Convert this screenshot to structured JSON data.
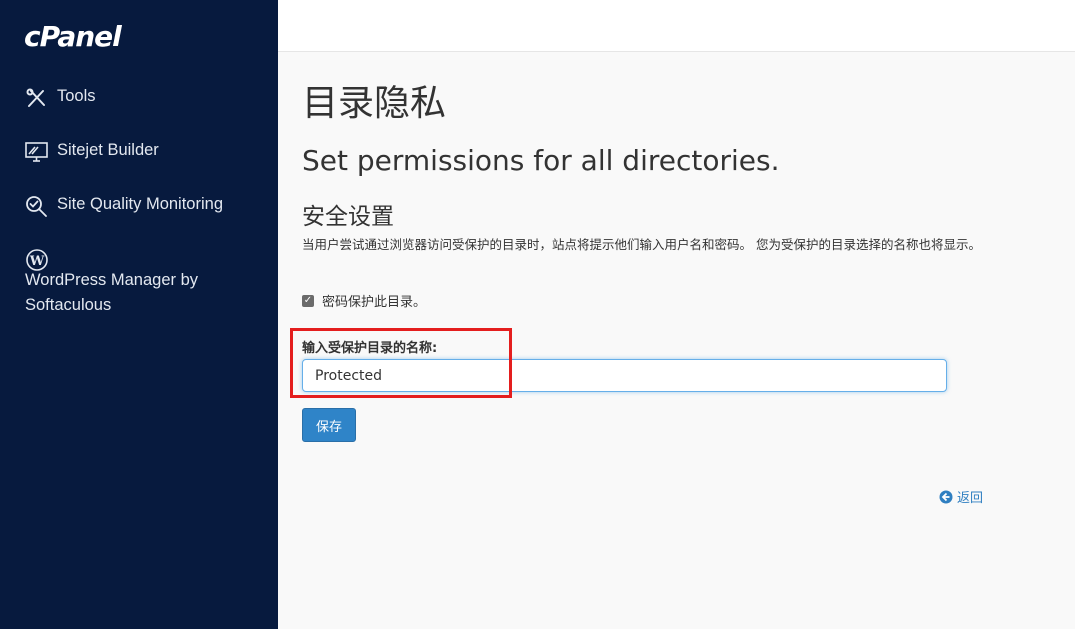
{
  "sidebar": {
    "logo": "cPanel",
    "items": [
      {
        "label": "Tools"
      },
      {
        "label": "Sitejet Builder"
      },
      {
        "label": "Site Quality Monitoring"
      },
      {
        "label": "WordPress Manager by",
        "label2": "Softaculous"
      }
    ]
  },
  "main": {
    "page_title": "目录隐私",
    "subtitle": "Set permissions for all directories.",
    "section_title": "安全设置",
    "description": "当用户尝试通过浏览器访问受保护的目录时，站点将提示他们输入用户名和密码。 您为受保护的目录选择的名称也将显示。",
    "checkbox_label": "密码保护此目录。",
    "checkbox_checked": true,
    "field_label": "输入受保护目录的名称:",
    "field_value": "Protected",
    "save_label": "保存",
    "back_label": "返回"
  },
  "colors": {
    "sidebar_bg": "#071a3e",
    "accent": "#2f84c8",
    "highlight": "#e41e1e"
  }
}
